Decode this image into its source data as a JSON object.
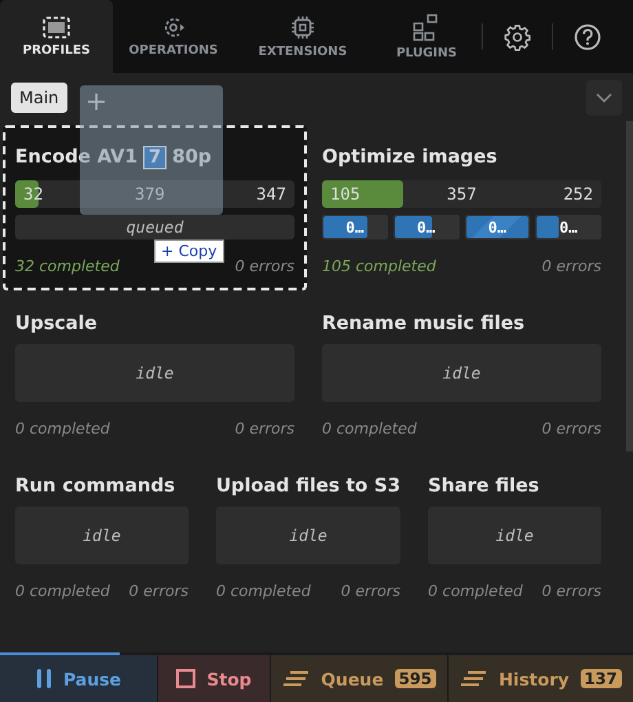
{
  "nav": {
    "tabs": [
      {
        "label": "PROFILES",
        "kind": "profiles",
        "selected": true
      },
      {
        "label": "OPERATIONS",
        "kind": "operations",
        "selected": false
      },
      {
        "label": "EXTENSIONS",
        "kind": "extensions",
        "selected": false
      },
      {
        "label": "PLUGINS",
        "kind": "plugins",
        "selected": false
      }
    ],
    "buttons": [
      {
        "kind": "settings"
      },
      {
        "kind": "help"
      }
    ]
  },
  "profile_bar": {
    "tabs": [
      {
        "label": "Main",
        "selected": true
      }
    ]
  },
  "drag": {
    "badge": "7",
    "tooltip": "+ Copy"
  },
  "rows": [
    {
      "cards": [
        {
          "title": "Encode AV1",
          "title_tail": "80p",
          "highlighted": true,
          "kind": "progress",
          "progress": {
            "level": 0.084,
            "done": "32",
            "total": "379",
            "remaining": "347"
          },
          "status": "queued",
          "completed": "32 completed",
          "errors": "0 errors"
        },
        {
          "title": "Optimize images",
          "highlighted": false,
          "kind": "progress",
          "progress": {
            "level": 0.29,
            "done": "105",
            "total": "357",
            "remaining": "252"
          },
          "workers": [
            {
              "label": "0…",
              "level": 0.7,
              "striped": false
            },
            {
              "label": "0…",
              "level": 0.6,
              "striped": false
            },
            {
              "label": "0…",
              "level": 1.0,
              "striped": true
            },
            {
              "label": "0…",
              "level": 0.35,
              "striped": false
            }
          ],
          "completed": "105 completed",
          "errors": "0 errors"
        }
      ]
    },
    {
      "cards": [
        {
          "title": "Upscale",
          "highlighted": false,
          "kind": "idle",
          "status": "idle",
          "completed": "0 completed",
          "errors": "0 errors"
        },
        {
          "title": "Rename music files",
          "highlighted": false,
          "kind": "idle",
          "status": "idle",
          "completed": "0 completed",
          "errors": "0 errors"
        }
      ]
    },
    {
      "cards": [
        {
          "title": "Run commands",
          "highlighted": false,
          "kind": "idle",
          "status": "idle",
          "completed": "0 completed",
          "errors": "0 errors"
        },
        {
          "title": "Upload files to S3",
          "highlighted": false,
          "kind": "idle",
          "status": "idle",
          "completed": "0 completed",
          "errors": "0 errors"
        },
        {
          "title": "Share files",
          "highlighted": false,
          "kind": "idle",
          "status": "idle",
          "completed": "0 completed",
          "errors": "0 errors"
        }
      ]
    }
  ],
  "footer": {
    "progress": {
      "level": 0.19
    },
    "buttons": [
      {
        "kind": "pause",
        "label": "Pause"
      },
      {
        "kind": "stop",
        "label": "Stop"
      },
      {
        "kind": "queue",
        "label": "Queue",
        "count": "595"
      },
      {
        "kind": "history",
        "label": "History",
        "count": "137"
      }
    ]
  }
}
